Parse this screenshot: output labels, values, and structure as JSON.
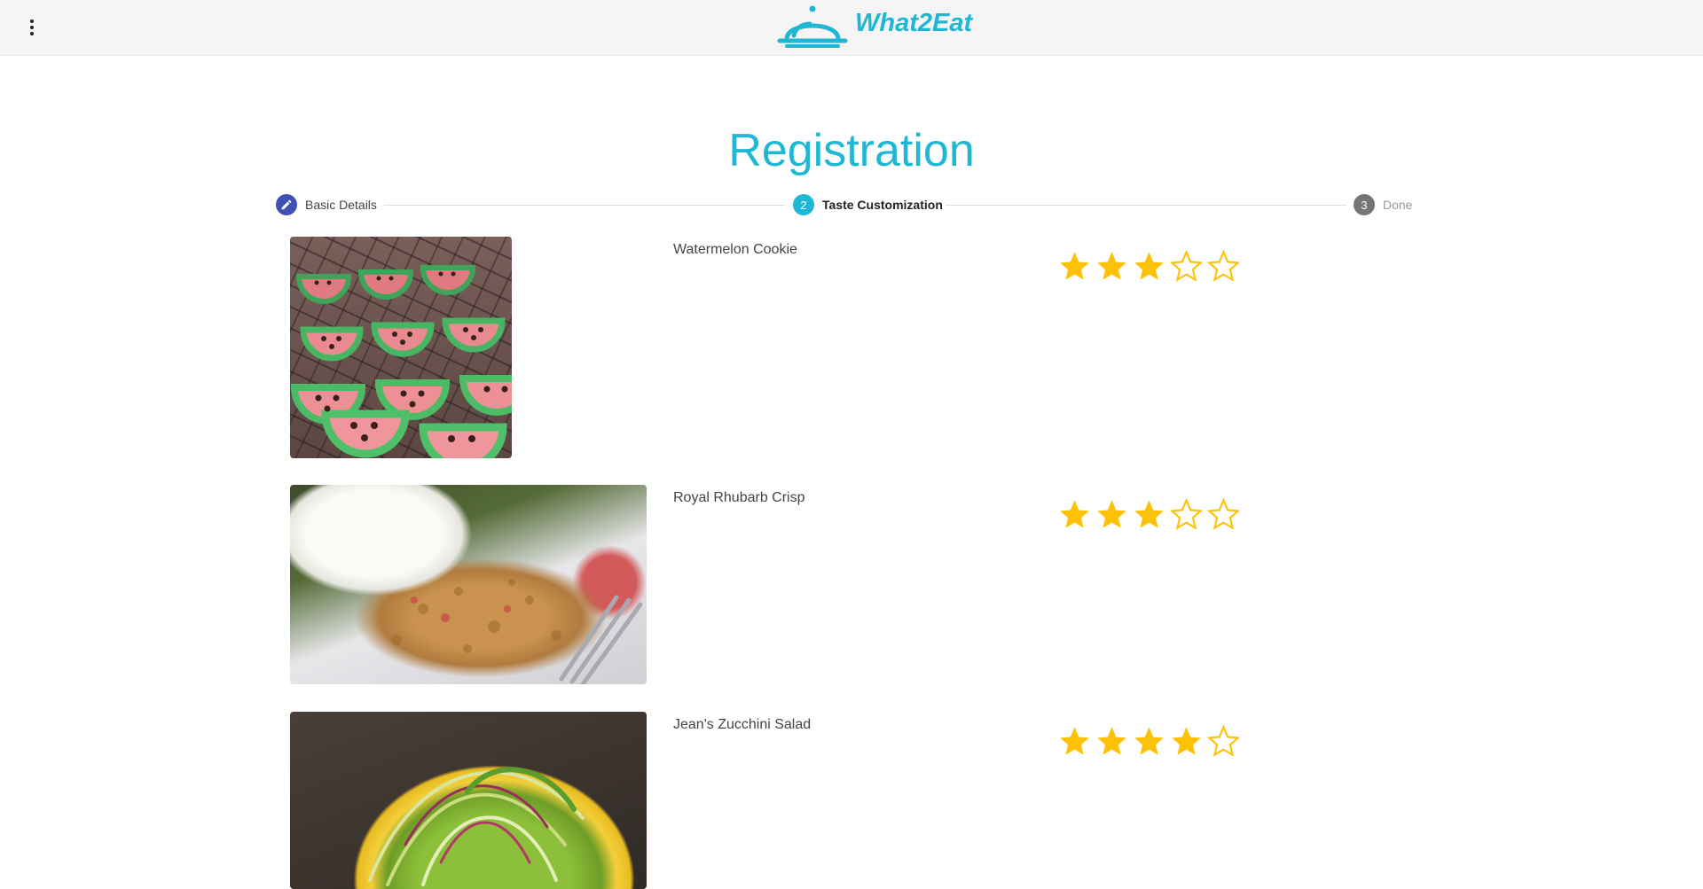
{
  "app": {
    "brand_name": "What2Eat",
    "accent_color": "#1fb7d3"
  },
  "header": {
    "menu_icon": "more-vert-icon",
    "logo_icon": "food-cloche-icon"
  },
  "page": {
    "title": "Registration"
  },
  "stepper": {
    "steps": [
      {
        "number": "1",
        "label": "Basic Details",
        "state": "completed",
        "icon": "edit-pencil-icon"
      },
      {
        "number": "2",
        "label": "Taste Customization",
        "state": "active"
      },
      {
        "number": "3",
        "label": "Done",
        "state": "upcoming"
      }
    ]
  },
  "foods": [
    {
      "name": "Watermelon Cookie",
      "rating": 3,
      "max_rating": 5
    },
    {
      "name": "Royal Rhubarb Crisp",
      "rating": 3,
      "max_rating": 5
    },
    {
      "name": "Jean's Zucchini Salad",
      "rating": 4,
      "max_rating": 5
    }
  ]
}
